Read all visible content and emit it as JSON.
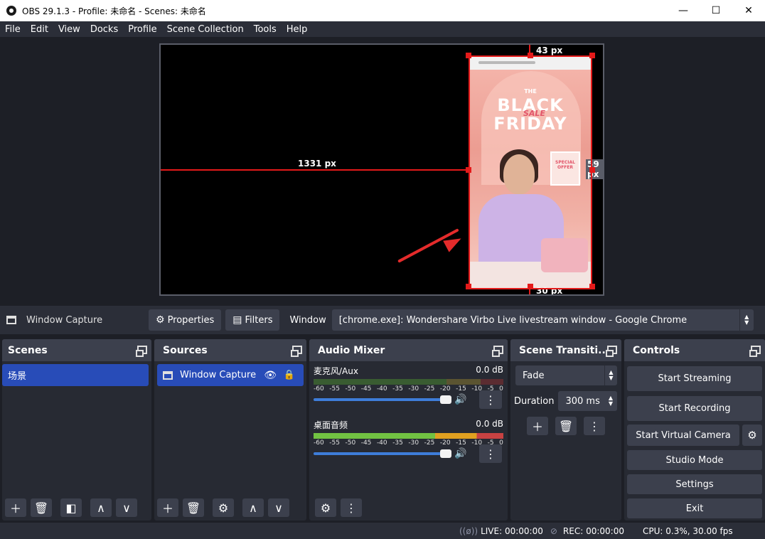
{
  "window": {
    "title": "OBS 29.1.3 - Profile: 未命名 - Scenes: 未命名",
    "minimize": "—",
    "maximize": "☐",
    "close": "✕"
  },
  "menu": [
    "File",
    "Edit",
    "View",
    "Docks",
    "Profile",
    "Scene Collection",
    "Tools",
    "Help"
  ],
  "preview": {
    "left_px": "1331 px",
    "top_px": "43 px",
    "right_px": "59 px",
    "bottom_px": "30 px",
    "promo_the": "THE",
    "promo_black": "BLACK",
    "promo_sale": "SALE",
    "promo_friday": "FRIDAY",
    "promo_offer": "SPECIAL OFFER"
  },
  "source_toolbar": {
    "source_name": "Window Capture",
    "properties": "Properties",
    "filters": "Filters",
    "window_label": "Window",
    "window_value": "[chrome.exe]: Wondershare Virbo Live livestream window - Google Chrome"
  },
  "scenes": {
    "title": "Scenes",
    "items": [
      "场景"
    ]
  },
  "sources": {
    "title": "Sources",
    "items": [
      "Window Capture"
    ]
  },
  "audio_mixer": {
    "title": "Audio Mixer",
    "channels": [
      {
        "name": "麦克风/Aux",
        "level": "0.0 dB"
      },
      {
        "name": "桌面音频",
        "level": "0.0 dB"
      }
    ],
    "scale": [
      "-60",
      "-55",
      "-50",
      "-45",
      "-40",
      "-35",
      "-30",
      "-25",
      "-20",
      "-15",
      "-10",
      "-5",
      "0"
    ]
  },
  "transitions": {
    "title": "Scene Transiti...",
    "selected": "Fade",
    "duration_label": "Duration",
    "duration_value": "300 ms"
  },
  "controls": {
    "title": "Controls",
    "start_streaming": "Start Streaming",
    "start_recording": "Start Recording",
    "start_virtual_camera": "Start Virtual Camera",
    "studio_mode": "Studio Mode",
    "settings": "Settings",
    "exit": "Exit"
  },
  "status": {
    "live": "LIVE: 00:00:00",
    "rec": "REC: 00:00:00",
    "cpu": "CPU: 0.3%, 30.00 fps"
  },
  "colors": {
    "accent": "#284cb8",
    "selection": "#e41a1a"
  }
}
